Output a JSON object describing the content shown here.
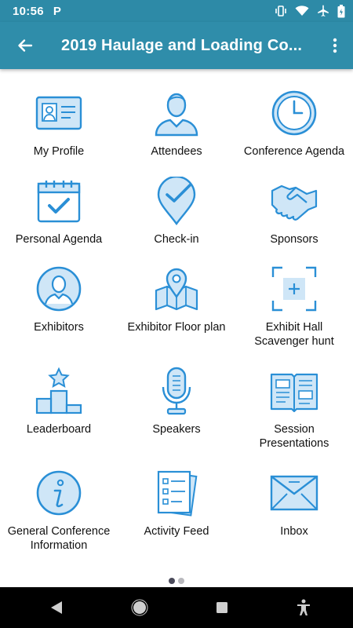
{
  "status": {
    "time": "10:56",
    "app_icon": "P"
  },
  "appbar": {
    "title": "2019 Haulage and Loading Co..."
  },
  "colors": {
    "accent": "#2f8daa",
    "icon_stroke": "#2a8fd6",
    "icon_fill": "#cfe6f7"
  },
  "tiles": [
    {
      "label": "My Profile",
      "icon": "id-card-icon"
    },
    {
      "label": "Attendees",
      "icon": "person-icon"
    },
    {
      "label": "Conference Agenda",
      "icon": "clock-icon"
    },
    {
      "label": "Personal Agenda",
      "icon": "calendar-check-icon"
    },
    {
      "label": "Check-in",
      "icon": "location-check-icon"
    },
    {
      "label": "Sponsors",
      "icon": "handshake-icon"
    },
    {
      "label": "Exhibitors",
      "icon": "person-circle-icon"
    },
    {
      "label": "Exhibitor Floor plan",
      "icon": "map-pin-icon"
    },
    {
      "label": "Exhibit Hall\nScavenger hunt",
      "icon": "scan-plus-icon"
    },
    {
      "label": "Leaderboard",
      "icon": "podium-star-icon"
    },
    {
      "label": "Speakers",
      "icon": "microphone-icon"
    },
    {
      "label": "Session\nPresentations",
      "icon": "open-book-icon"
    },
    {
      "label": "General Conference\nInformation",
      "icon": "info-icon"
    },
    {
      "label": "Activity Feed",
      "icon": "checklist-icon"
    },
    {
      "label": "Inbox",
      "icon": "envelope-icon"
    }
  ]
}
